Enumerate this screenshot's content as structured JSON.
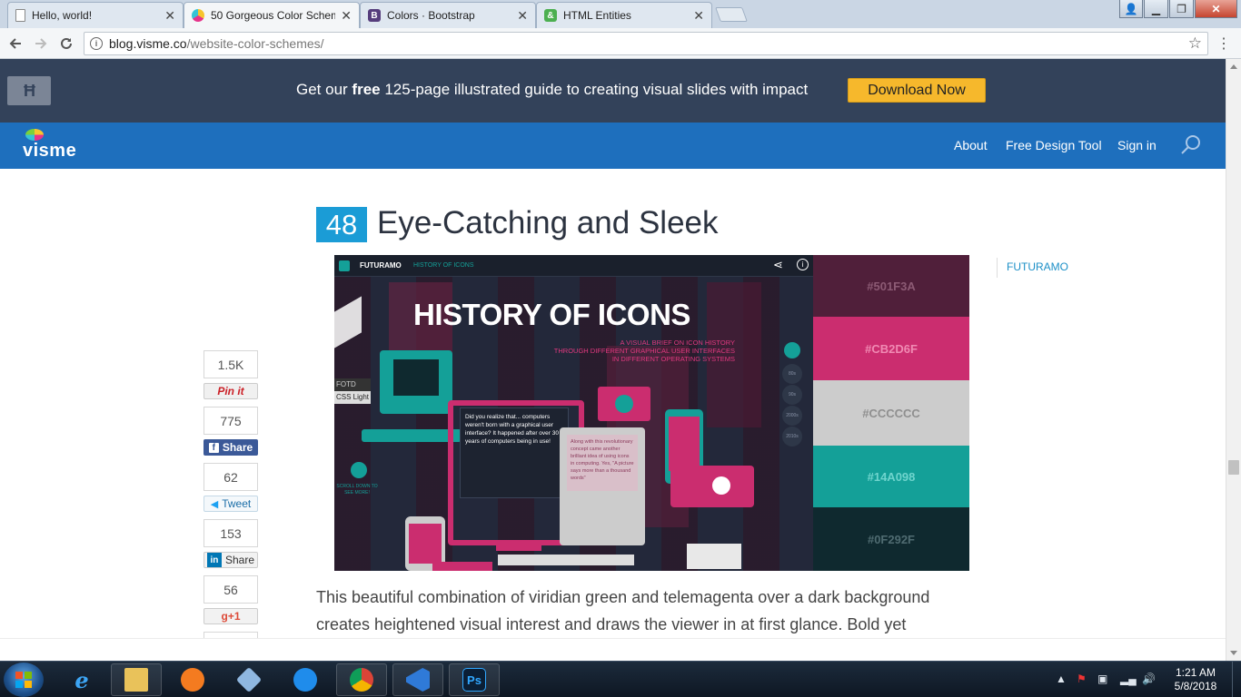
{
  "browser": {
    "tabs": [
      {
        "title": "Hello, world!",
        "favicon": "document-icon"
      },
      {
        "title": "50 Gorgeous Color Schem",
        "favicon": "visme-icon",
        "active": true
      },
      {
        "title": "Colors · Bootstrap",
        "favicon": "bootstrap-icon",
        "favicon_letter": "B"
      },
      {
        "title": "HTML Entities",
        "favicon": "html-entities-icon",
        "favicon_letter": "&"
      }
    ],
    "tab_close": "✕",
    "window_controls": {
      "user": "👤",
      "minimize": "▁",
      "maximize": "❐",
      "close": "✕"
    },
    "url_host": "blog.visme.co",
    "url_path": "/website-color-schemes/"
  },
  "promo": {
    "logo_text": "Ħ",
    "text_before": "Get our ",
    "text_bold": "free",
    "text_after": " 125-page illustrated guide to creating visual slides with impact",
    "button": "Download Now"
  },
  "nav": {
    "brand": "visme",
    "links": [
      "About",
      "Free Design Tool",
      "Sign in"
    ]
  },
  "article": {
    "number": "48",
    "heading": "Eye-Catching and Sleek",
    "source_tag": "FUTURAMO",
    "body": "This beautiful combination of viridian green and telemagenta over a dark background creates heightened visual interest and draws the viewer in at first glance. Bold yet"
  },
  "screenshot": {
    "brand": "FUTURAMO",
    "menu": "HISTORY OF ICONS",
    "title": "HISTORY OF ICONS",
    "subtitle_lines": [
      "A VISUAL BRIEF ON ICON HISTORY",
      "THROUGH DIFFERENT GRAPHICAL USER INTERFACES",
      "IN DIFFERENT OPERATING SYSTEMS"
    ],
    "callout": "Did you realize that... computers weren't born with a graphical user interface? It happened after over 30 years of computers being in use!",
    "callout2": "Along with this revolutionary concept came another brilliant idea of using icons in computing. Yes, \"A picture says more than a thousand words\"",
    "scroll_hint": "SCROLL DOWN TO SEE MORE!",
    "sidebar_badges": [
      "FOTD",
      "CSS Light"
    ],
    "timeline": [
      "80s",
      "90s",
      "2000s",
      "2010s"
    ]
  },
  "palette": [
    {
      "hex": "#501F3A",
      "label": "#501F3A",
      "text_color": "#8c5a74"
    },
    {
      "hex": "#CB2D6F",
      "label": "#CB2D6F",
      "text_color": "#f08ab3"
    },
    {
      "hex": "#CCCCCC",
      "label": "#CCCCCC",
      "text_color": "#8f8f8f"
    },
    {
      "hex": "#14A098",
      "label": "#14A098",
      "text_color": "#6fd4cd"
    },
    {
      "hex": "#0F292F",
      "label": "#0F292F",
      "text_color": "#4f6b71"
    }
  ],
  "share": [
    {
      "count": "1.5K",
      "label": "Pin it",
      "network": "pinterest",
      "color": "#cb2027"
    },
    {
      "count": "775",
      "label": "Share",
      "network": "facebook",
      "color": "#3b5998"
    },
    {
      "count": "62",
      "label": "Tweet",
      "network": "twitter",
      "color": "#1da1f2"
    },
    {
      "count": "153",
      "label": "Share",
      "network": "linkedin",
      "color": "#0077b5"
    },
    {
      "count": "56",
      "label": "+1",
      "network": "google-plus",
      "color": "#dd4b39"
    }
  ],
  "taskbar": {
    "apps": [
      "file-explorer-icon",
      "internet-explorer-icon",
      "uc-browser-icon",
      "package-icon",
      "teamviewer-icon",
      "chrome-icon",
      "visual-studio-icon",
      "photoshop-icon"
    ],
    "photoshop_label": "Ps",
    "time": "1:21 AM",
    "date": "5/8/2018"
  }
}
